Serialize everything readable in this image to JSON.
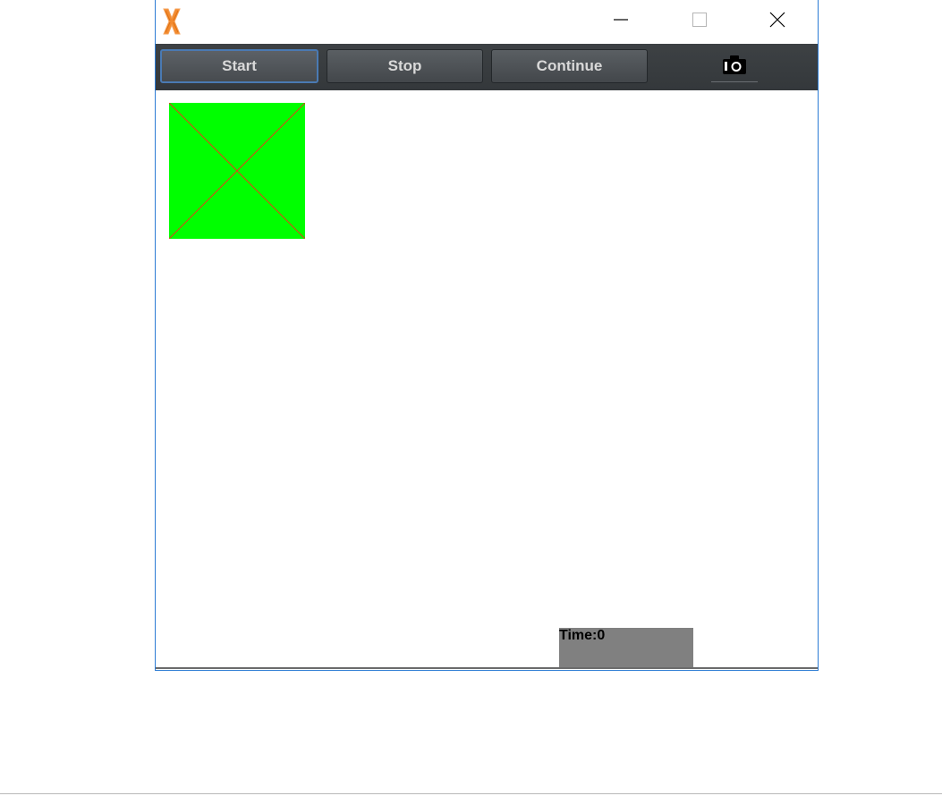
{
  "window": {
    "app_icon": "orange-x-logo-icon",
    "controls": {
      "minimize_icon": "minimize-icon",
      "maximize_icon": "maximize-icon",
      "close_icon": "close-icon"
    }
  },
  "toolbar": {
    "start_label": "Start",
    "stop_label": "Stop",
    "continue_label": "Continue",
    "camera_icon": "camera-icon"
  },
  "canvas": {
    "sprite": {
      "fill_color": "#00ff00",
      "cross_color": "#e0401a"
    },
    "timer": {
      "label": "Time:0",
      "background_color": "#808080"
    }
  },
  "colors": {
    "accent": "#2b7bd4",
    "toolbar_bg": "#3a3e41",
    "button_text": "#d9d9d9",
    "logo_orange": "#f28a2e"
  }
}
